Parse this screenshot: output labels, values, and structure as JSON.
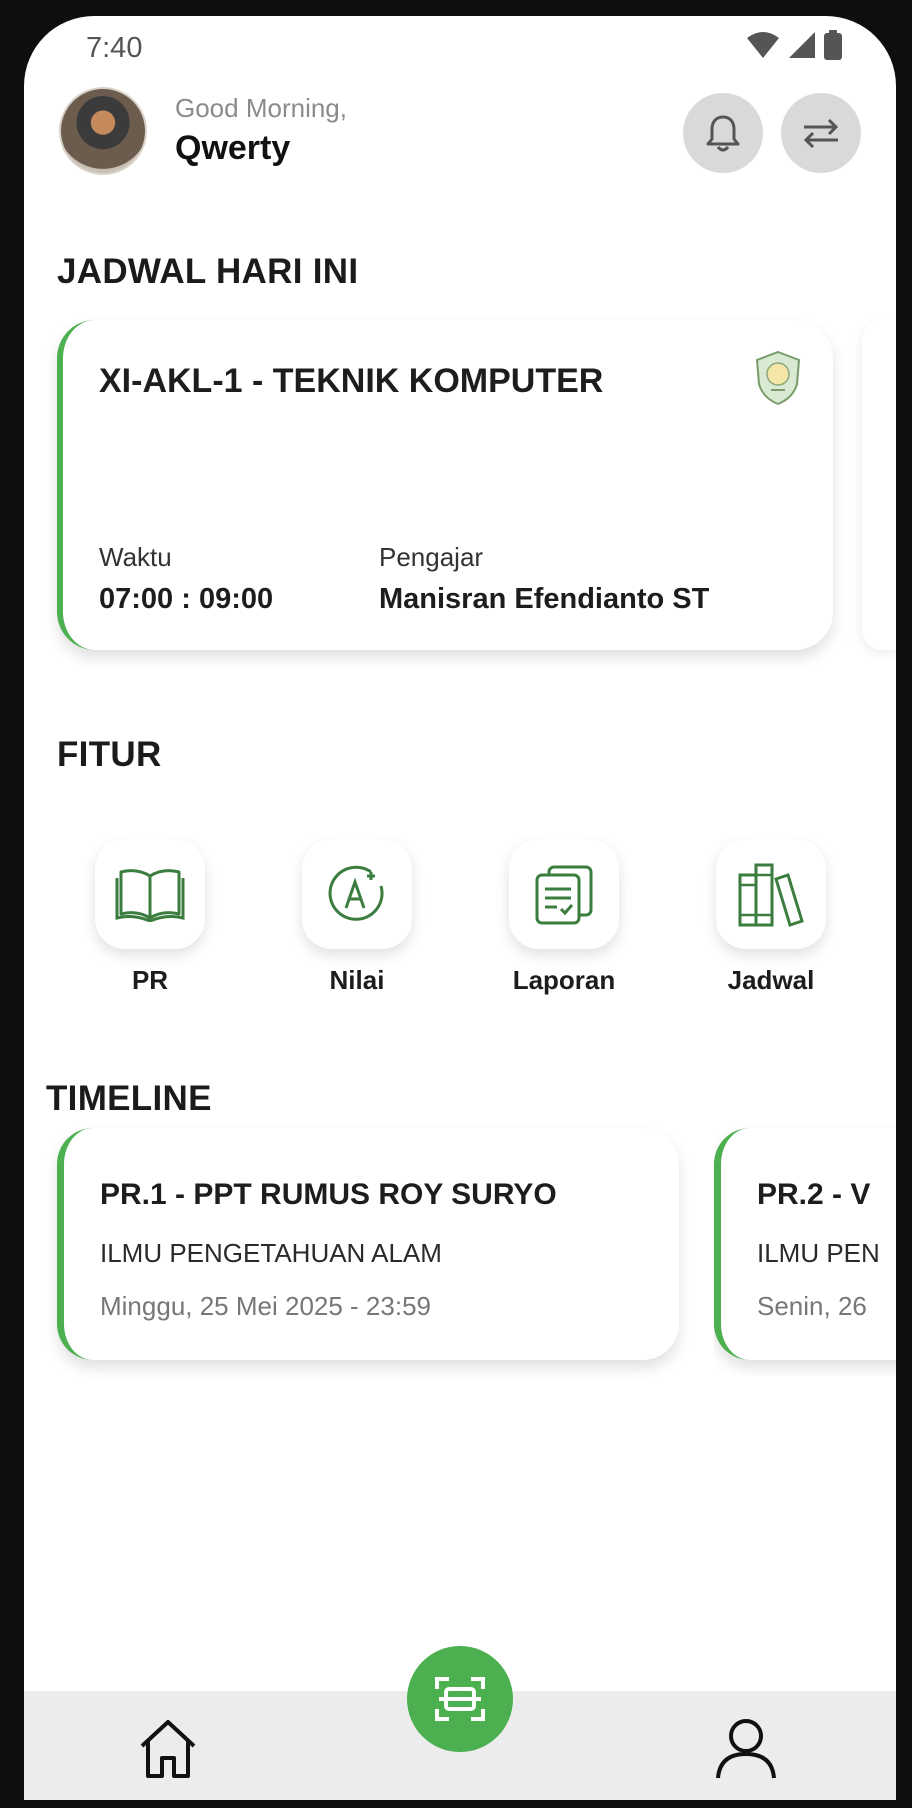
{
  "status_bar": {
    "time": "7:40"
  },
  "header": {
    "greeting": "Good Morning,",
    "username": "Qwerty"
  },
  "schedule": {
    "section_title": "JADWAL HARI INI",
    "card": {
      "class_title": "XI-AKL-1 - TEKNIK KOMPUTER",
      "time_label": "Waktu",
      "time_value": "07:00 : 09:00",
      "teacher_label": "Pengajar",
      "teacher_value": "Manisran Efendianto ST"
    }
  },
  "features": {
    "section_title": "FITUR",
    "items": [
      {
        "label": "PR",
        "icon": "book-icon"
      },
      {
        "label": "Nilai",
        "icon": "grade-a-plus-icon"
      },
      {
        "label": "Laporan",
        "icon": "report-icon"
      },
      {
        "label": "Jadwal",
        "icon": "books-icon"
      }
    ]
  },
  "timeline": {
    "section_title": "TIMELINE",
    "items": [
      {
        "title": "PR.1 - PPT RUMUS ROY SURYO",
        "subject": "ILMU PENGETAHUAN ALAM",
        "due": "Minggu, 25 Mei 2025 - 23:59"
      },
      {
        "title": "PR.2 - V",
        "subject": "ILMU PEN",
        "due": "Senin, 26"
      }
    ]
  },
  "colors": {
    "accent": "#4caf50",
    "icon_green": "#3a7d3e",
    "nav_bg": "#ececec"
  },
  "icons": {
    "notification": "bell-icon",
    "switch": "swap-arrows-icon",
    "scan": "scan-icon",
    "home": "home-icon",
    "profile": "person-icon"
  }
}
